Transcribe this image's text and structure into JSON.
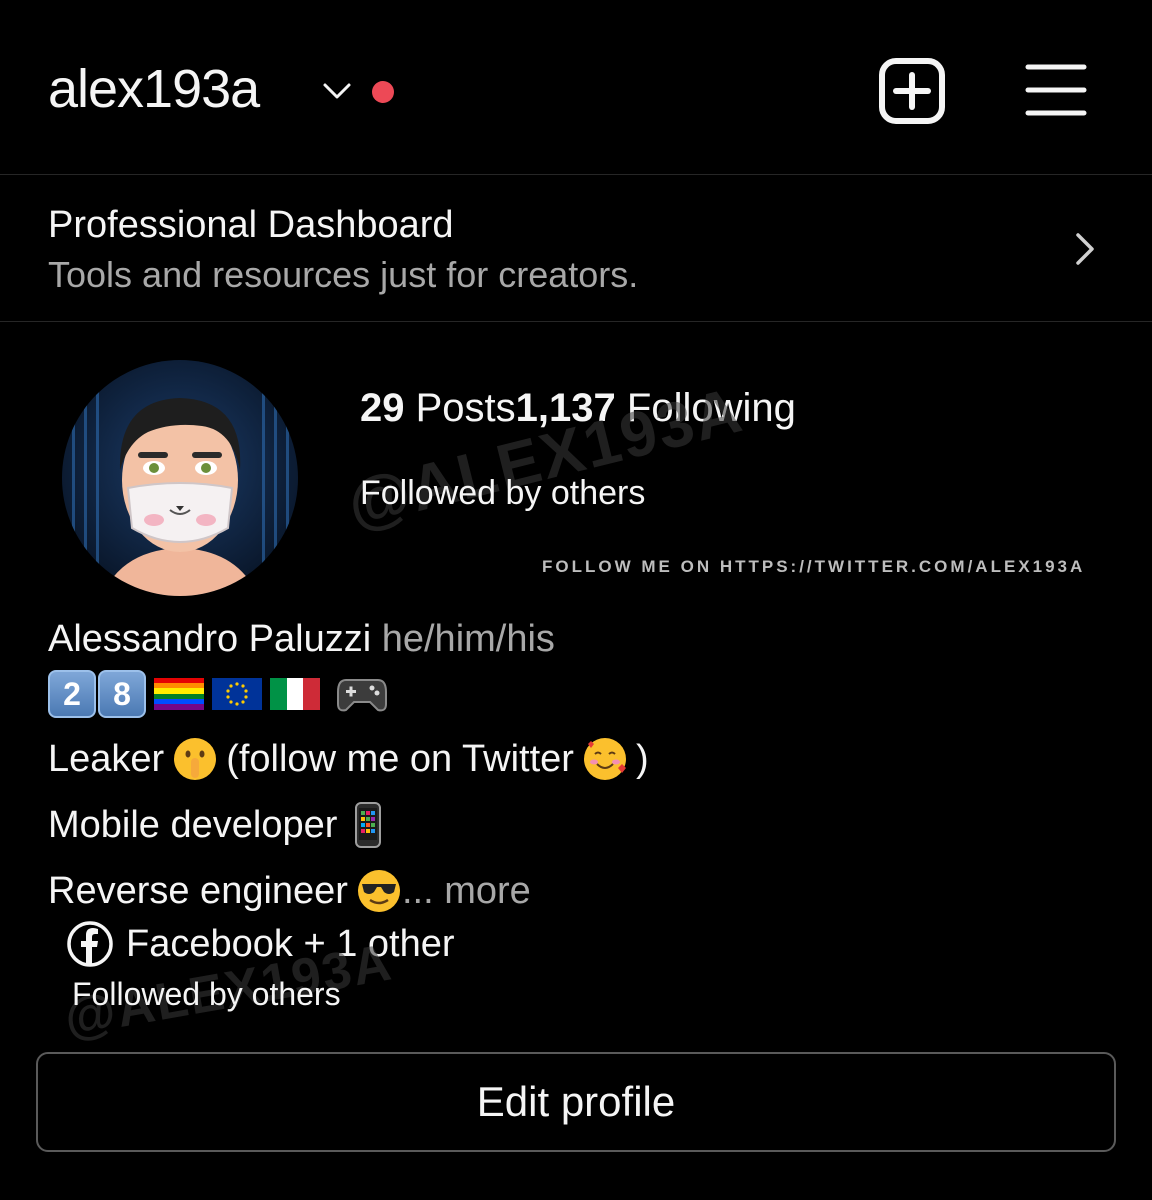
{
  "header": {
    "username": "alex193a",
    "notification_color": "#ed4956"
  },
  "dashboard": {
    "title": "Professional Dashboard",
    "subtitle": "Tools and resources just for creators."
  },
  "profile": {
    "posts_count": "29",
    "posts_label": "Posts",
    "following_count": "1,137",
    "following_label": "Following",
    "followed_by": "Followed by others",
    "watermark": "@ALEX193A",
    "follow_note": "FOLLOW ME ON HTTPS://TWITTER.COM/ALEX193A"
  },
  "bio": {
    "name": "Alessandro Paluzzi",
    "pronouns": "he/him/his",
    "age_keys": [
      "2",
      "8"
    ],
    "emoji_icons": [
      "rainbow-flag-icon",
      "eu-flag-icon",
      "italy-flag-icon",
      "game-controller-icon"
    ],
    "line1_a": "Leaker",
    "line1_b": "(follow me on Twitter",
    "line1_c": ")",
    "line2": "Mobile developer",
    "line3": "Reverse engineer",
    "more": "... more"
  },
  "links": {
    "label": "Facebook + 1 other",
    "followed_by": "Followed by others",
    "watermark": "@ALEX193A"
  },
  "actions": {
    "edit_profile": "Edit profile"
  }
}
